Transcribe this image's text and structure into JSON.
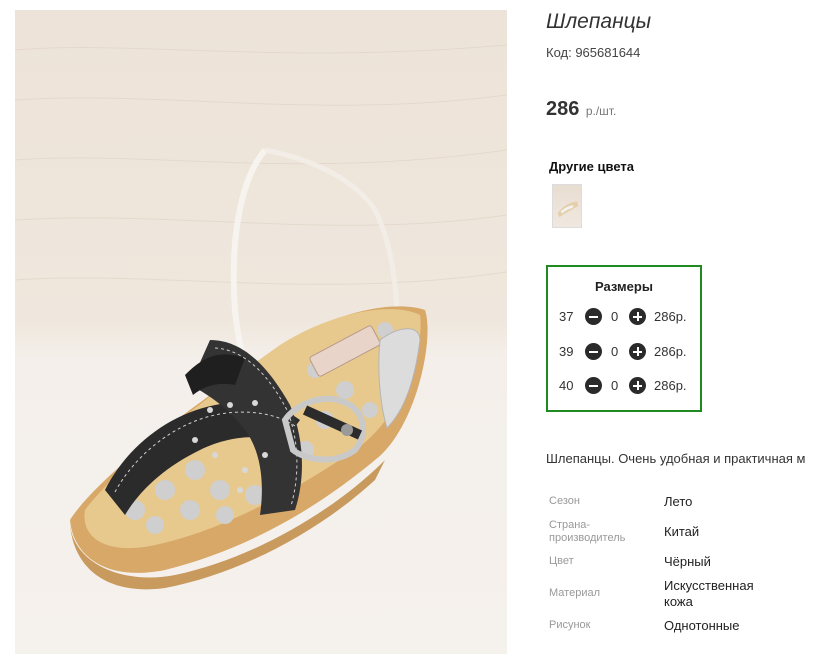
{
  "product": {
    "title": "Шлепанцы",
    "code": "Код: 965681644",
    "price": "286",
    "price_unit": "р./шт.",
    "description": "Шлепанцы. Очень удобная и практичная м"
  },
  "other_colors": {
    "title": "Другие цвета"
  },
  "sizes": {
    "title": "Размеры",
    "rows": [
      {
        "size": "37",
        "qty": "0",
        "price": "286р."
      },
      {
        "size": "39",
        "qty": "0",
        "price": "286р."
      },
      {
        "size": "40",
        "qty": "0",
        "price": "286р."
      }
    ]
  },
  "properties": [
    {
      "key": "Сезон",
      "value": "Лето"
    },
    {
      "key": "Страна-\nпроизводитель",
      "value": "Китай"
    },
    {
      "key": "Цвет",
      "value": "Чёрный"
    },
    {
      "key": "Материал",
      "value": "Искусственная\nкожа"
    },
    {
      "key": "Рисунок",
      "value": "Однотонные"
    }
  ],
  "colors": {
    "accent_border": "#1f8a1f",
    "button": "#2a2a2a"
  }
}
